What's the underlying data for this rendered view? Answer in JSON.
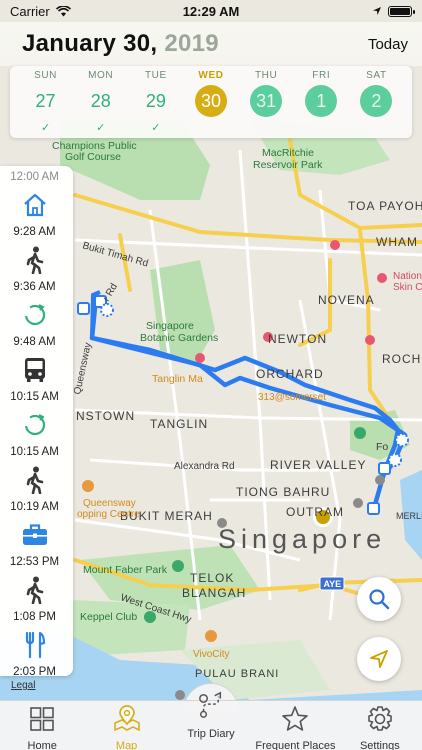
{
  "status": {
    "carrier": "Carrier",
    "time": "12:29 AM"
  },
  "header": {
    "month_day": "January 30",
    "comma": ",",
    "year": " 2019",
    "today_label": "Today"
  },
  "week": [
    {
      "name": "SUN",
      "num": "27",
      "check": "✓",
      "state": "past"
    },
    {
      "name": "MON",
      "num": "28",
      "check": "✓",
      "state": "past"
    },
    {
      "name": "TUE",
      "num": "29",
      "check": "✓",
      "state": "past"
    },
    {
      "name": "WED",
      "num": "30",
      "check": "",
      "state": "active"
    },
    {
      "name": "THU",
      "num": "31",
      "check": "",
      "state": "future"
    },
    {
      "name": "FRI",
      "num": "1",
      "check": "",
      "state": "future"
    },
    {
      "name": "SAT",
      "num": "2",
      "check": "",
      "state": "future"
    }
  ],
  "timeline": {
    "start_time": "12:00 AM",
    "items": [
      {
        "icon": "home-icon",
        "time": "9:28 AM"
      },
      {
        "icon": "walk-icon",
        "time": "9:36 AM"
      },
      {
        "icon": "loading-icon",
        "time": "9:48 AM"
      },
      {
        "icon": "bus-icon",
        "time": "10:15 AM"
      },
      {
        "icon": "loading-icon",
        "time": "10:15 AM"
      },
      {
        "icon": "walk-icon",
        "time": "10:19 AM"
      },
      {
        "icon": "briefcase-icon",
        "time": "12:53 PM"
      },
      {
        "icon": "walk-icon",
        "time": "1:08 PM"
      },
      {
        "icon": "fork-knife-icon",
        "time": "2:03 PM"
      }
    ]
  },
  "map": {
    "labels": {
      "champions": "Champions Public",
      "golf": "Golf Course",
      "macritchie": "MacRitchie",
      "reservoir": "Reservoir Park",
      "toa_payoh": "TOA PAYOH",
      "bukit_timah": "Bukit Timah Rd",
      "r_rd": "r Rd",
      "wham": "WHAM",
      "national": "Nation",
      "skin": "Skin C",
      "novena": "NOVENA",
      "singapore": "Singapore",
      "botanic": "Botanic Gardens",
      "newton": "NEWTON",
      "rocho": "ROCHO",
      "queensway": "Queensway",
      "tanglin_mall": "Tanglin Ma",
      "orchard": "ORCHARD",
      "somerset": "313@somerset",
      "nstown": "NSTOWN",
      "tanglin": "TANGLIN",
      "fo": "Fo",
      "alexandra": "Alexandra Rd",
      "river_valley": "RIVER VALLEY",
      "tiong_bahru": "TIONG BAHRU",
      "outram": "OUTRAM",
      "merlion": "MERLION",
      "bukit_merah": "BUKIT MERAH",
      "queensway2": "Queensway",
      "shopping": "opping Centre",
      "singapore_big": "Singapore",
      "mount_faber": "Mount Faber Park",
      "west_coast": "West Coast Hwy",
      "telok": "TELOK",
      "blangah": "BLANGAH",
      "aye": "AYE",
      "keppel": "Keppel Club",
      "vivocity": "VivoCity",
      "pulau": "PULAU BRANI"
    }
  },
  "legal": "Legal",
  "tabs": [
    {
      "label": "Home",
      "icon": "grid-icon"
    },
    {
      "label": "Map",
      "icon": "map-pin-icon"
    },
    {
      "label": "Trip Diary",
      "icon": "route-icon"
    },
    {
      "label": "Frequent Places",
      "icon": "star-icon"
    },
    {
      "label": "Settings",
      "icon": "gear-icon"
    }
  ],
  "colors": {
    "accent": "#d6ad12",
    "green": "#2fb07d",
    "route": "#2d7bf0",
    "icon_blue": "#2f86e0"
  }
}
